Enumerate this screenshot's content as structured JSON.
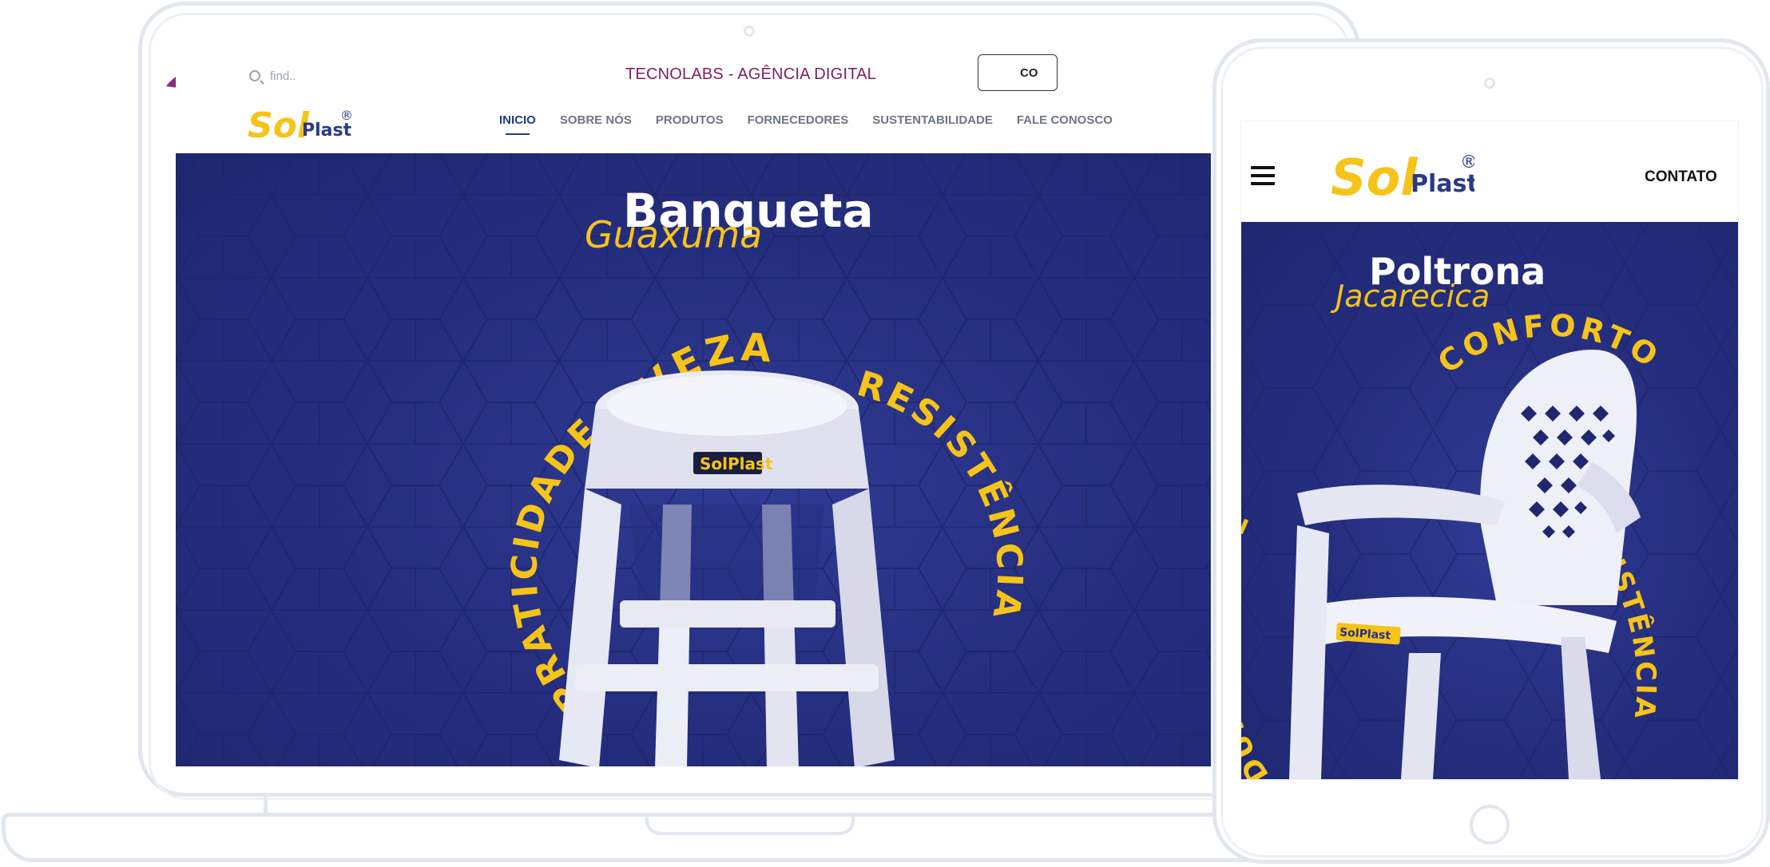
{
  "agency": "TECNOLABS - AGÊNCIA DIGITAL",
  "desktop": {
    "search_placeholder": "find..",
    "nav": [
      {
        "label": "INICIO",
        "active": true
      },
      {
        "label": "SOBRE NÓS"
      },
      {
        "label": "PRODUTOS"
      },
      {
        "label": "FORNECEDORES"
      },
      {
        "label": "SUSTENTABILIDADE"
      },
      {
        "label": "FALE CONOSCO"
      }
    ],
    "contact_button": "CO",
    "hero": {
      "title": "Banqueta",
      "script": "Guaxuma",
      "word_top": "LEVEZA",
      "word_left": "PRATICIDADE",
      "word_right": "RESISTÊNCIA",
      "label": "SolPlast"
    }
  },
  "mobile": {
    "contact_link": "CONTATO",
    "hero": {
      "title": "Poltrona",
      "script": "Jacarecica",
      "word_top": "CONFORTO",
      "word_left": "DURABILIDADE",
      "word_right": "RESISTÊNCIA",
      "label": "SolPlast"
    }
  },
  "logo": {
    "sol": "Sol",
    "plast": "Plast",
    "mark": "®"
  },
  "colors": {
    "accent_yellow": "#f6c319",
    "navy": "#262f80",
    "agency_purple": "#7d1f63",
    "active_nav": "#213a8f"
  }
}
